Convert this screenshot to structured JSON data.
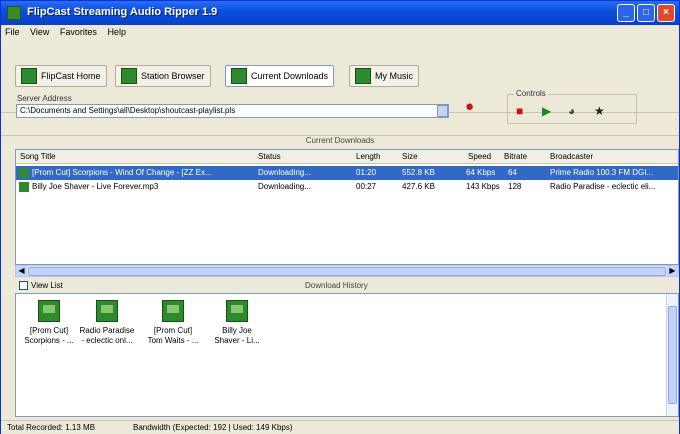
{
  "window": {
    "title": "FlipCast Streaming Audio Ripper 1.9"
  },
  "menu": [
    "File",
    "View",
    "Favorites",
    "Help"
  ],
  "nav": [
    {
      "label": "FlipCast Home"
    },
    {
      "label": "Station Browser"
    },
    {
      "label": "Current Downloads"
    },
    {
      "label": "My Music"
    }
  ],
  "server": {
    "label": "Server Address",
    "value": "C:\\Documents and Settings\\all\\Desktop\\shoutcast-playlist.pls"
  },
  "controls": {
    "label": "Controls"
  },
  "downloads": {
    "header": "Current Downloads",
    "columns": [
      "Song Title",
      "Status",
      "Length",
      "Size",
      "Speed",
      "Bitrate",
      "Broadcaster"
    ],
    "rows": [
      {
        "title": "[Prom Cut] Scorpions - Wind Of Change - [ZZ Ex...",
        "status": "Downloading...",
        "length": "01:20",
        "size": "552.8 KB",
        "speed": "64 Kbps",
        "bitrate": "64",
        "broadcaster": "Prime Radio 100.3 FM DGI...",
        "selected": true
      },
      {
        "title": "Billy Joe Shaver - Live Forever.mp3",
        "status": "Downloading...",
        "length": "00:27",
        "size": "427.6 KB",
        "speed": "143 Kbps",
        "bitrate": "128",
        "broadcaster": "Radio Paradise - eclectic eli...",
        "selected": false
      }
    ]
  },
  "download_history": {
    "checkbox_label": "View List",
    "header": "Download History",
    "items": [
      {
        "line1": "[Prom Cut]",
        "line2": "Scorpions - ..."
      },
      {
        "line1": "Radio Paradise",
        "line2": "- eclectic onl..."
      },
      {
        "line1": "[Prom Cut]",
        "line2": "Tom Waits - ..."
      },
      {
        "line1": "Billy Joe",
        "line2": "Shaver - Li..."
      }
    ]
  },
  "status": {
    "total": "Total Recorded: 1.13 MB",
    "bandwidth": "Bandwidth (Expected: 192 | Used: 149 Kbps)"
  }
}
